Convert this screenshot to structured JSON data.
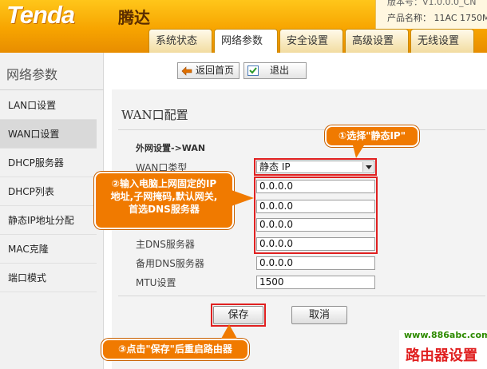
{
  "header": {
    "logo_text": "Tenda",
    "logo_cn": "腾达",
    "info_line1": "版本号：V1.0.0.0_CN",
    "info_line2": "产品名称： 11AC 1750M",
    "tabs": [
      {
        "label": "系统状态",
        "active": false
      },
      {
        "label": "网络参数",
        "active": true
      },
      {
        "label": "安全设置",
        "active": false
      },
      {
        "label": "高级设置",
        "active": false
      },
      {
        "label": "无线设置",
        "active": false
      }
    ]
  },
  "sidebar": {
    "title": "网络参数",
    "items": [
      {
        "label": "LAN口设置",
        "active": false
      },
      {
        "label": "WAN口设置",
        "active": true
      },
      {
        "label": "DHCP服务器",
        "active": false
      },
      {
        "label": "DHCP列表",
        "active": false
      },
      {
        "label": "静态IP地址分配",
        "active": false
      },
      {
        "label": "MAC克隆",
        "active": false
      },
      {
        "label": "端口模式",
        "active": false
      }
    ]
  },
  "toolbar": {
    "home_label": "返回首页",
    "exit_label": "退出"
  },
  "main": {
    "title": "WAN口配置",
    "section_label": "外网设置->WAN",
    "wan_type_label": "WAN口类型",
    "wan_type_value": "静态 IP",
    "ip_value": "0.0.0.0",
    "mask_value": "0.0.0.0",
    "gateway_value": "0.0.0.0",
    "dns1_label": "主DNS服务器",
    "dns1_value": "0.0.0.0",
    "dns2_label": "备用DNS服务器",
    "dns2_value": "0.0.0.0",
    "mtu_label": "MTU设置",
    "mtu_value": "1500",
    "save_label": "保存",
    "cancel_label": "取消"
  },
  "callouts": {
    "step1": "①选择\"静态IP\"",
    "step2_line1": "②输入电脑上网固定的IP",
    "step2_line2": "地址,子网掩码,默认网关,",
    "step2_line3": "首选DNS服务器",
    "step3": "③点击\"保存\"后重启路由器"
  },
  "watermark": {
    "url": "www.886abc.com",
    "site_name": "路由器设置"
  },
  "colors": {
    "header_orange": "#f7a400",
    "callout_orange": "#f07a00",
    "highlight_red": "#e02020"
  }
}
